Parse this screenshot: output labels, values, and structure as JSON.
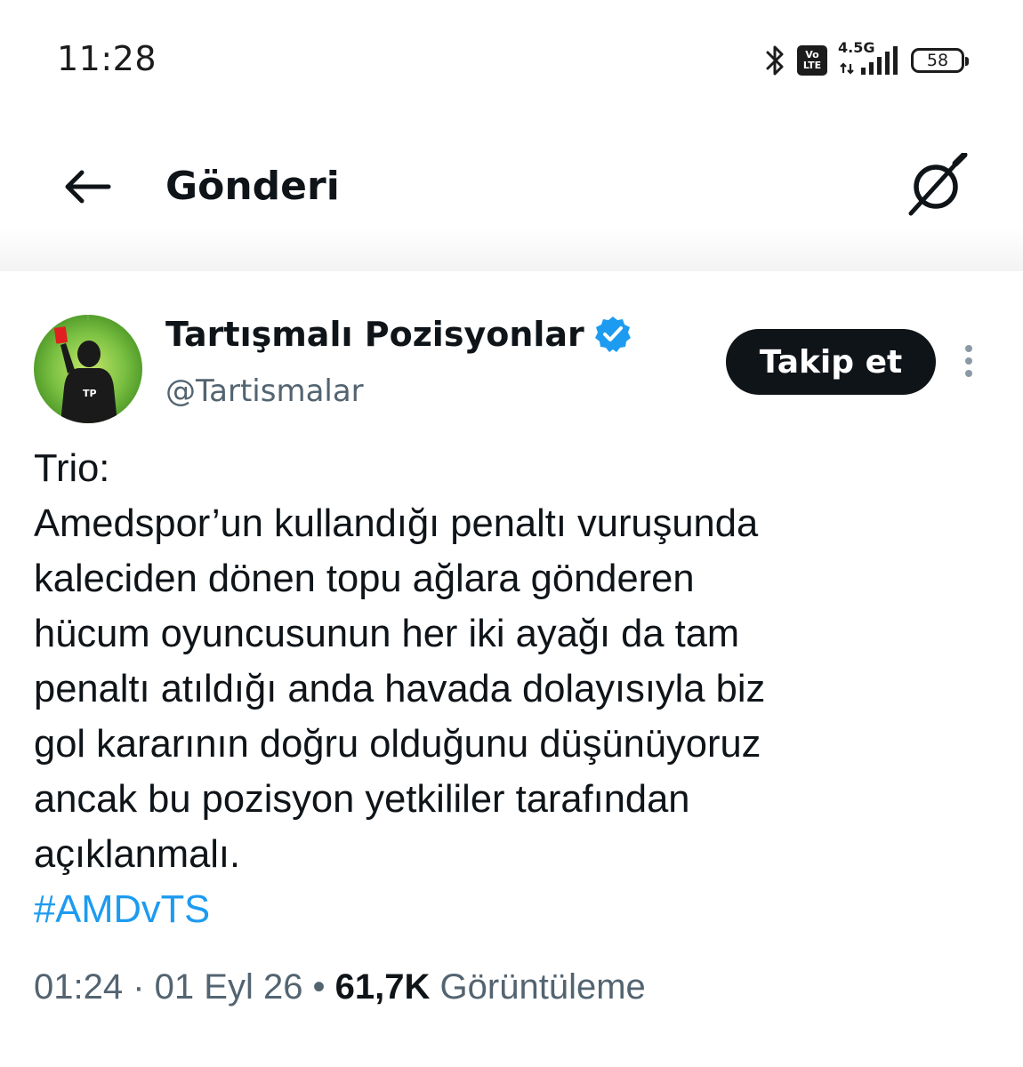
{
  "status_bar": {
    "time": "11:28",
    "volte_top": "Vo",
    "volte_bottom": "LTE",
    "network": "4.5G",
    "battery": "58",
    "icons": [
      "bluetooth-icon",
      "volte-icon",
      "signal-icon",
      "battery-icon"
    ]
  },
  "header": {
    "title": "Gönderi",
    "back_icon": "arrow-left-icon",
    "grok_icon": "grok-icon"
  },
  "author": {
    "name": "Tartışmalı Pozisyonlar",
    "handle": "@Tartismalar",
    "verified": true,
    "follow_label": "Takip et"
  },
  "tweet": {
    "lines": [
      "Trio:",
      "Amedspor’un kullandığı penaltı vuruşunda",
      "kaleciden dönen topu ağlara gönderen",
      "hücum oyuncusunun her iki ayağı da tam",
      "penaltı atıldığı anda havada dolayısıyla biz",
      "gol kararının doğru olduğunu düşünüyoruz",
      "ancak bu pozisyon yetkililer tarafından",
      "açıklanmalı."
    ],
    "hashtag": "#AMDvTS"
  },
  "meta": {
    "time": "01:24",
    "sep1": " · ",
    "date": "01 Eyl 26",
    "sep2": " • ",
    "views": "61,7K",
    "views_label": " Görüntüleme"
  },
  "colors": {
    "text": "#0f1419",
    "secondary": "#536471",
    "link": "#1d9bf0",
    "verified": "#1d9bf0",
    "avatar_green": "#7bc143"
  }
}
